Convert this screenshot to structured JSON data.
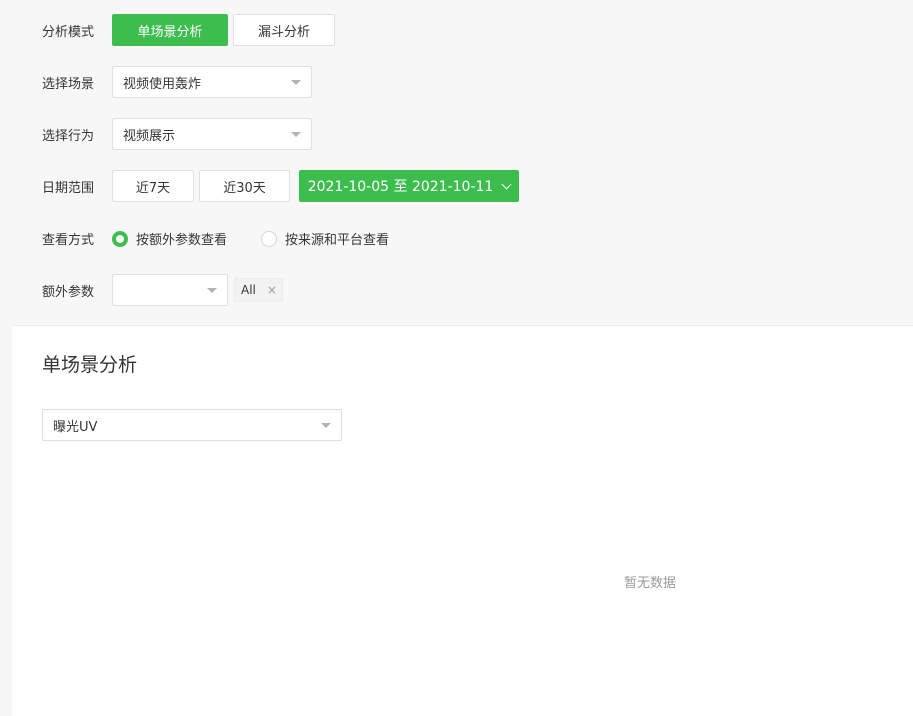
{
  "filters": {
    "mode": {
      "label": "分析模式",
      "options": [
        "单场景分析",
        "漏斗分析"
      ],
      "selected": "单场景分析"
    },
    "scene": {
      "label": "选择场景",
      "value": "视频使用轰炸"
    },
    "action": {
      "label": "选择行为",
      "value": "视频展示"
    },
    "date": {
      "label": "日期范围",
      "quick7": "近7天",
      "quick30": "近30天",
      "range": "2021-10-05 至 2021-10-11"
    },
    "view": {
      "label": "查看方式",
      "options": [
        "按额外参数查看",
        "按来源和平台查看"
      ],
      "selected": "按额外参数查看"
    },
    "extra": {
      "label": "额外参数",
      "value": "",
      "tag": "All",
      "tag_close": "×"
    }
  },
  "panel": {
    "title": "单场景分析",
    "metric": "曝光UV",
    "empty_text": "暂无数据"
  },
  "colors": {
    "accent": "#3ebd4f"
  }
}
